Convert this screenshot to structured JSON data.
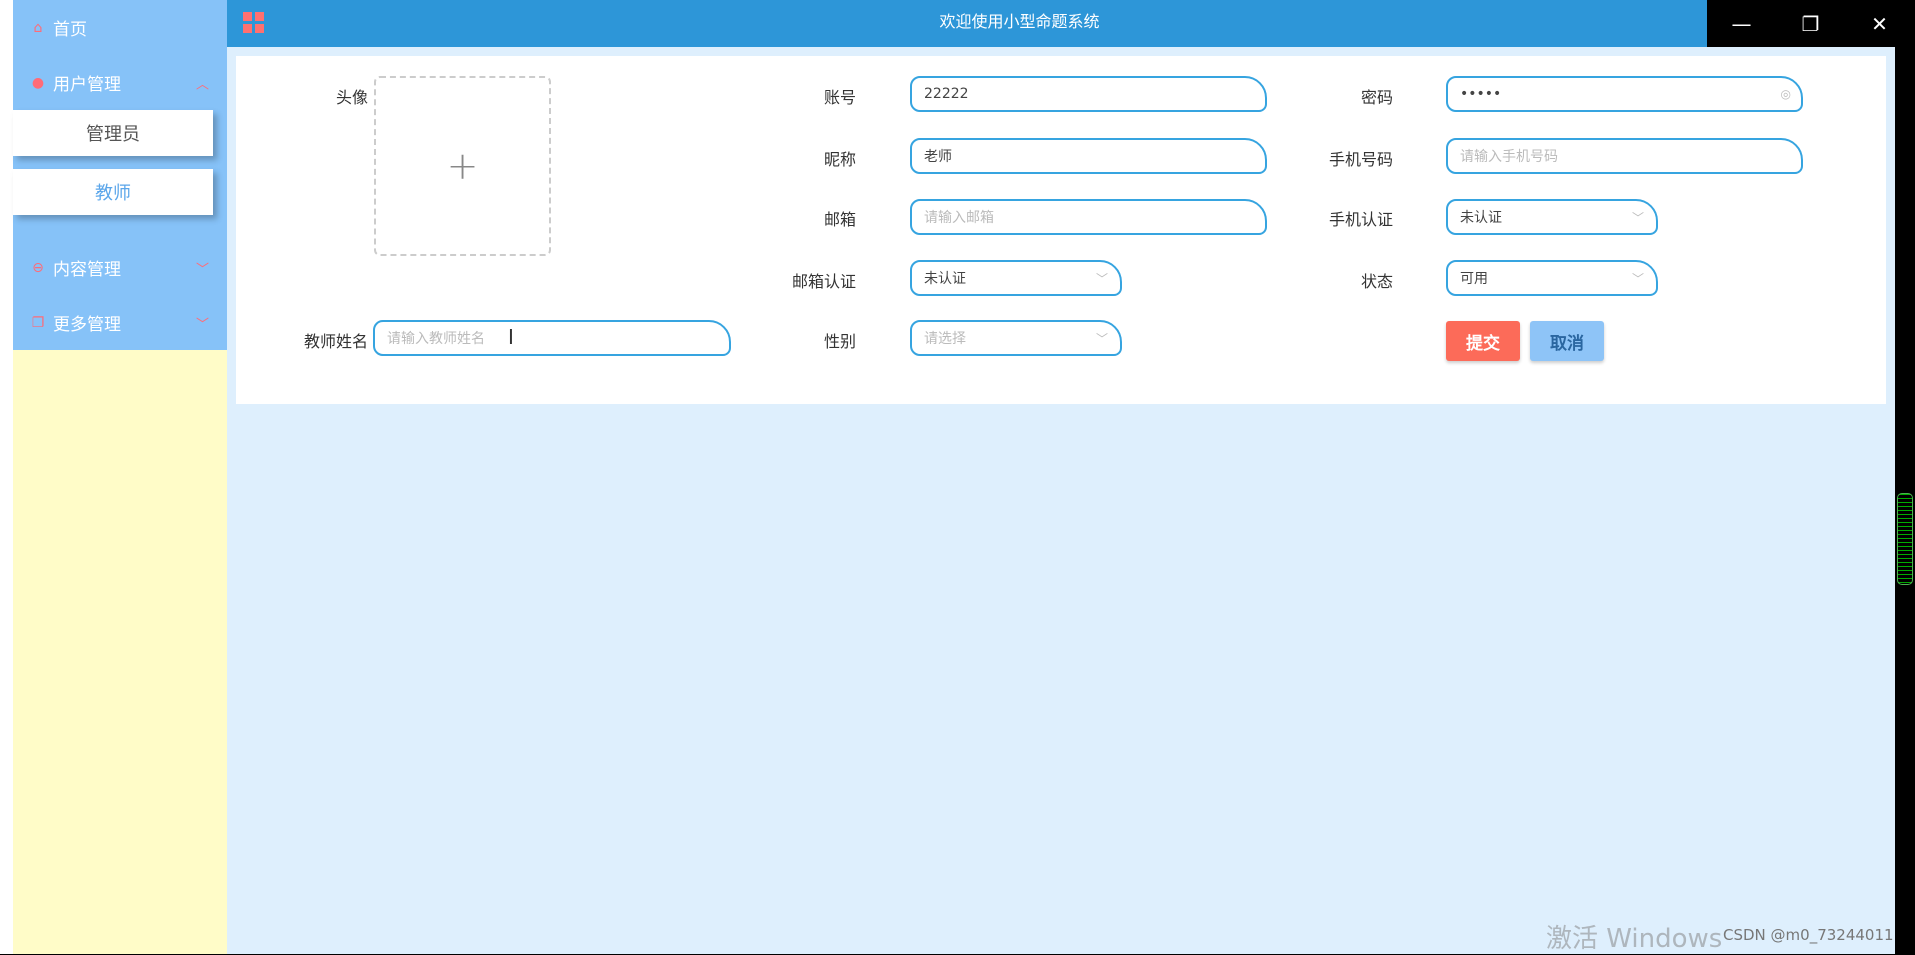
{
  "app": {
    "title": "欢迎使用小型命题系统"
  },
  "sidebar": {
    "home": "首页",
    "user_mgmt": "用户管理",
    "user_sub": [
      "管理员",
      "教师"
    ],
    "content_mgmt": "内容管理",
    "more_mgmt": "更多管理"
  },
  "form": {
    "avatar_label": "头像",
    "account_label": "账号",
    "account_value": "22222",
    "password_label": "密码",
    "password_value": "•••••",
    "nickname_label": "昵称",
    "nickname_value": "老师",
    "phone_label": "手机号码",
    "phone_placeholder": "请输入手机号码",
    "email_label": "邮箱",
    "email_placeholder": "请输入邮箱",
    "phone_verify_label": "手机认证",
    "phone_verify_value": "未认证",
    "email_verify_label": "邮箱认证",
    "email_verify_value": "未认证",
    "status_label": "状态",
    "status_value": "可用",
    "teacher_name_label": "教师姓名",
    "teacher_name_placeholder": "请输入教师姓名",
    "gender_label": "性别",
    "gender_placeholder": "请选择",
    "submit": "提交",
    "cancel": "取消"
  },
  "watermark": {
    "activate": "激活 Windows",
    "csdn": "CSDN @m0_73244011"
  },
  "colors": {
    "topbar": "#2d96d8",
    "sidebar_menu": "#86c2f8",
    "sidebar_bg": "#fffcc8",
    "accent": "#ff6b78",
    "submit": "#fc6b59",
    "cancel": "#8ec4f7"
  },
  "icons": {
    "home": "home-icon",
    "user": "user-icon",
    "content": "message-icon",
    "more": "copy-icon",
    "grid": "grid-icon"
  }
}
